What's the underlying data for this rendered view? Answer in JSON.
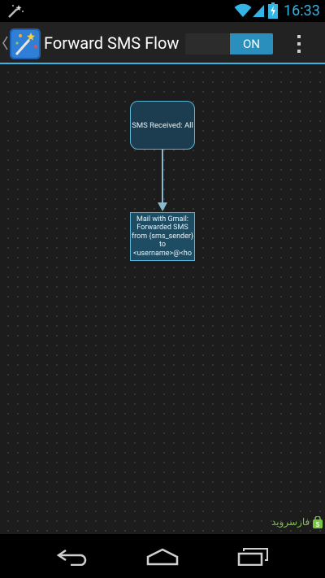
{
  "status_bar": {
    "time": "16:33",
    "icons": [
      "magic-wand-icon",
      "wifi-icon",
      "signal-icon",
      "battery-charging-icon"
    ],
    "accent_color": "#33b5e5"
  },
  "action_bar": {
    "title": "Forward SMS Flow",
    "toggle_label": "ON",
    "toggle_color": "#2a8fbd",
    "icons": [
      "up-caret-icon",
      "app-icon",
      "overflow-menu-icon"
    ],
    "underline_color": "#33b5e5"
  },
  "flow": {
    "trigger_node": {
      "label": "SMS Received: All"
    },
    "action_node": {
      "label": "Mail with Gmail: Forwarded SMS from {sms_sender} to <username>@<ho"
    }
  },
  "watermark": {
    "text": "فارسروید"
  },
  "nav_bar": {
    "icons": [
      "back-icon",
      "home-icon",
      "recents-icon"
    ]
  }
}
